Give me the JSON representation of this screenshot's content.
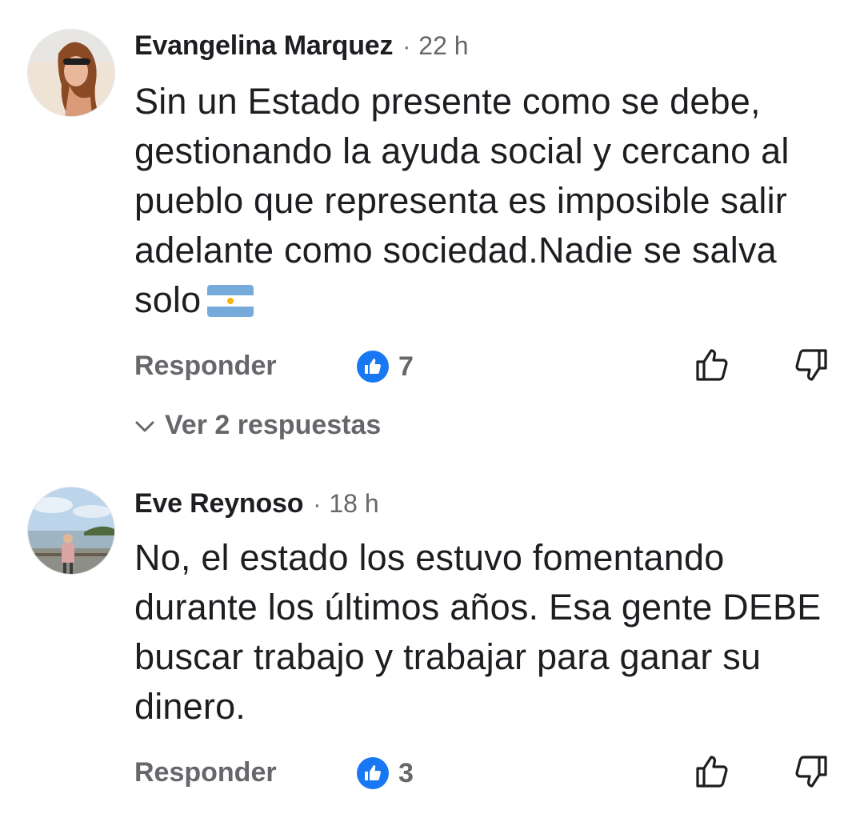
{
  "comments": [
    {
      "author": "Evangelina Marquez",
      "separator": "·",
      "time": "22 h",
      "text": "Sin un Estado presente como se debe, gestionando la ayuda social y cercano al pueblo que representa es imposible salir adelante como sociedad.Nadie se salva solo",
      "emoji": "argentina-flag",
      "reply_label": "Responder",
      "reaction_icon": "like-icon",
      "reaction_count": "7",
      "replies_label": "Ver 2 respuestas"
    },
    {
      "author": "Eve Reynoso",
      "separator": "·",
      "time": "18 h",
      "text": "No, el estado los estuvo fomentando durante los últimos años. Esa gente DEBE buscar trabajo y trabajar para ganar su dinero.",
      "reply_label": "Responder",
      "reaction_icon": "like-icon",
      "reaction_count": "3"
    }
  ],
  "colors": {
    "like_blue": "#1877f2",
    "meta_gray": "#65676b",
    "text": "#1c1e21",
    "flag_blue": "#75aadb",
    "flag_sun": "#f6b40e"
  }
}
